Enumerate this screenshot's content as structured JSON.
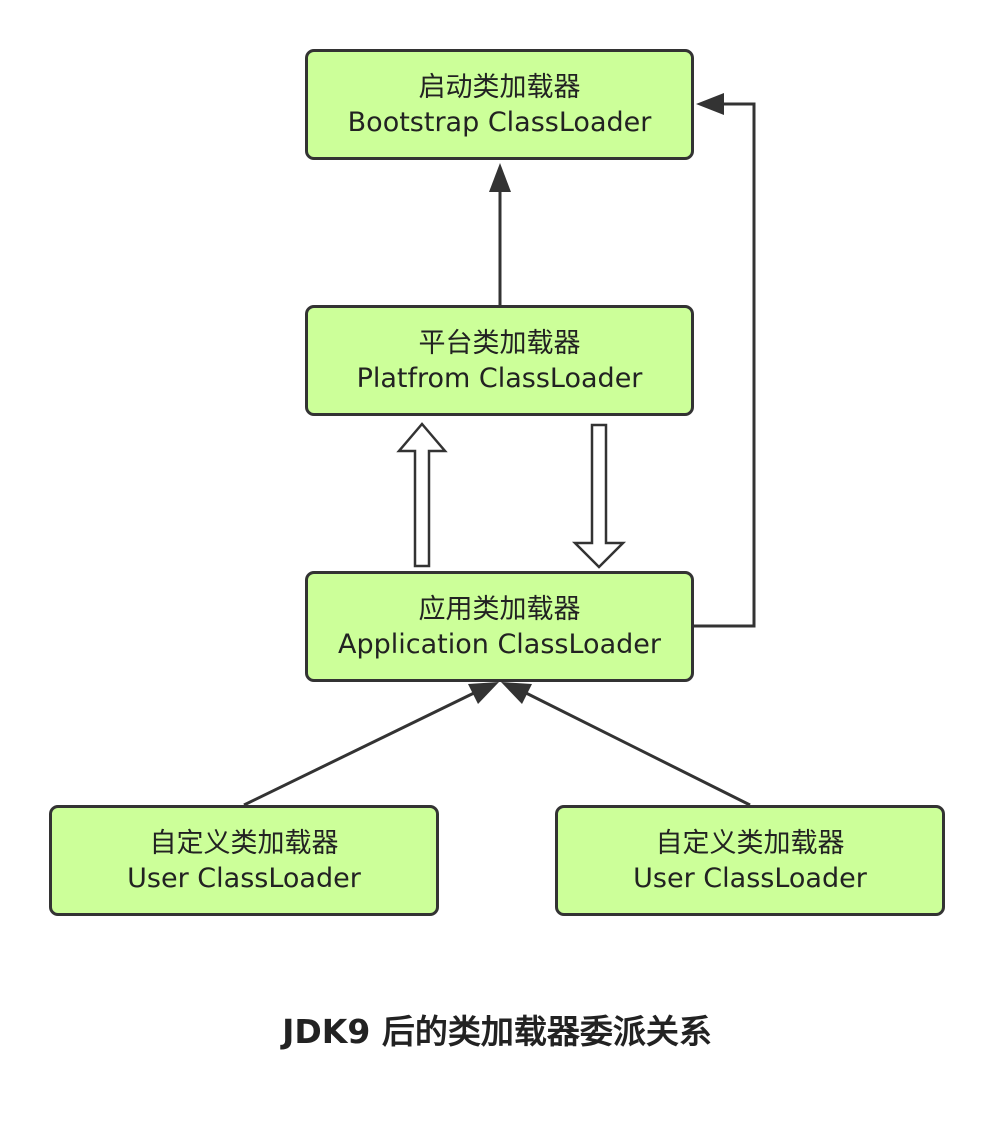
{
  "nodes": {
    "bootstrap": {
      "name_cn": "启动类加载器",
      "name_en": "Bootstrap ClassLoader"
    },
    "platform": {
      "name_cn": "平台类加载器",
      "name_en": "Platfrom ClassLoader"
    },
    "application": {
      "name_cn": "应用类加载器",
      "name_en": "Application ClassLoader"
    },
    "user_left": {
      "name_cn": "自定义类加载器",
      "name_en": "User ClassLoader"
    },
    "user_right": {
      "name_cn": "自定义类加载器",
      "name_en": "User ClassLoader"
    }
  },
  "caption": "JDK9 后的类加载器委派关系",
  "colors": {
    "node_fill": "#ccff99",
    "node_border": "#333333",
    "arrow": "#333333",
    "text": "#222222"
  },
  "edges": [
    {
      "from": "platform",
      "to": "bootstrap",
      "style": "solid"
    },
    {
      "from": "application",
      "to": "bootstrap",
      "style": "solid-elbow"
    },
    {
      "from": "application",
      "to": "platform",
      "style": "hollow"
    },
    {
      "from": "platform",
      "to": "application",
      "style": "hollow"
    },
    {
      "from": "user_left",
      "to": "application",
      "style": "solid"
    },
    {
      "from": "user_right",
      "to": "application",
      "style": "solid"
    }
  ]
}
